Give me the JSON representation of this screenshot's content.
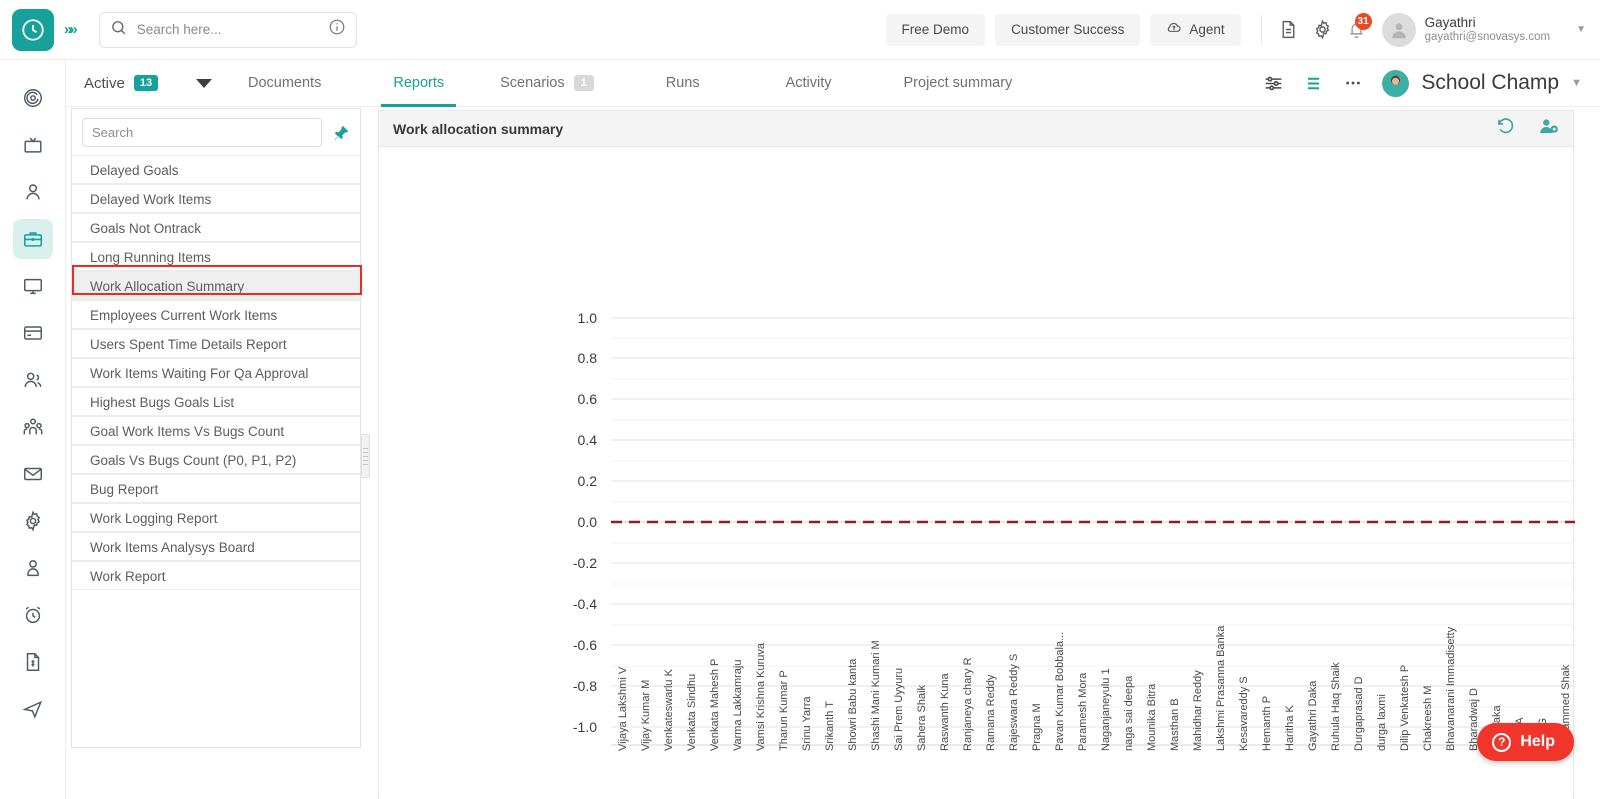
{
  "header": {
    "logo_icon": "clock-logo-icon",
    "expand_icon": "double-chevron-right-icon",
    "search_placeholder": "Search here...",
    "search_value": "",
    "search_icon": "search-icon",
    "info_icon": "info-circle-icon",
    "buttons": [
      {
        "label": "Free Demo",
        "icon": ""
      },
      {
        "label": "Customer Success",
        "icon": ""
      },
      {
        "label": "Agent",
        "icon": "cloud-upload-icon"
      }
    ],
    "doc_icon": "document-icon",
    "gear_icon": "gear-icon",
    "bell_icon": "bell-icon",
    "notification_count": "31",
    "avatar_icon": "avatar",
    "user_name": "Gayathri",
    "user_email": "gayathri@snovasys.com",
    "caret_icon": "chevron-down-icon"
  },
  "sidebar": {
    "items": [
      {
        "name": "target-icon"
      },
      {
        "name": "tv-icon"
      },
      {
        "name": "person-icon"
      },
      {
        "name": "briefcase-icon",
        "active": true
      },
      {
        "name": "monitor-icon"
      },
      {
        "name": "card-icon"
      },
      {
        "name": "two-people-icon"
      },
      {
        "name": "group-people-icon"
      },
      {
        "name": "mail-icon"
      },
      {
        "name": "settings-gear-icon"
      },
      {
        "name": "user-profile-icon"
      },
      {
        "name": "alarm-clock-icon"
      },
      {
        "name": "invoice-icon"
      },
      {
        "name": "send-icon"
      }
    ]
  },
  "tabbar": {
    "active_label": "Active",
    "active_count": "13",
    "dropdown_icon": "triangle-down-icon",
    "tabs": [
      {
        "label": "Documents",
        "selected": false,
        "badge": ""
      },
      {
        "label": "Reports",
        "selected": true,
        "badge": ""
      },
      {
        "label": "Scenarios",
        "selected": false,
        "badge": "1"
      },
      {
        "label": "Runs",
        "selected": false,
        "badge": ""
      },
      {
        "label": "Activity",
        "selected": false,
        "badge": ""
      },
      {
        "label": "Project summary",
        "selected": false,
        "badge": ""
      }
    ],
    "filter_icon": "filter-sliders-icon",
    "list_icon": "list-lines-icon",
    "more_icon": "more-horizontal-icon",
    "project_avatar": "project-avatar",
    "project_name": "School Champ",
    "project_caret": "chevron-down-icon"
  },
  "reportlist": {
    "search_placeholder": "Search",
    "search_value": "",
    "pin_icon": "pin-icon",
    "items": [
      {
        "label": "Delayed Goals",
        "selected": false
      },
      {
        "label": "Delayed Work Items",
        "selected": false
      },
      {
        "label": "Goals Not Ontrack",
        "selected": false
      },
      {
        "label": "Long Running Items",
        "selected": false
      },
      {
        "label": "Work Allocation Summary",
        "selected": true
      },
      {
        "label": "Employees Current Work Items",
        "selected": false
      },
      {
        "label": "Users Spent Time Details Report",
        "selected": false
      },
      {
        "label": "Work Items Waiting For Qa Approval",
        "selected": false
      },
      {
        "label": "Highest Bugs Goals List",
        "selected": false
      },
      {
        "label": "Goal Work Items Vs Bugs Count",
        "selected": false
      },
      {
        "label": "Goals Vs Bugs Count (P0, P1, P2)",
        "selected": false
      },
      {
        "label": "Bug Report",
        "selected": false
      },
      {
        "label": "Work Logging Report",
        "selected": false
      },
      {
        "label": "Work Items Analysys Board",
        "selected": false
      },
      {
        "label": "Work Report",
        "selected": false
      }
    ],
    "resizer_icon": "panel-resize-handle"
  },
  "chart_panel": {
    "title": "Work allocation summary",
    "refresh_icon": "undo-refresh-icon",
    "assign_user_icon": "user-settings-icon"
  },
  "chart_data": {
    "type": "bar",
    "title": "Work allocation summary",
    "xlabel": "",
    "ylabel": "",
    "ylim": [
      -1.0,
      1.0
    ],
    "ytick_labels": [
      "1.0",
      "0.8",
      "0.6",
      "0.4",
      "0.2",
      "0.0",
      "-0.2",
      "-0.4",
      "-0.6",
      "-0.8",
      "-1.0"
    ],
    "ytick_values": [
      1.0,
      0.8,
      0.6,
      0.4,
      0.2,
      0.0,
      -0.2,
      -0.4,
      -0.6,
      -0.8,
      -1.0
    ],
    "grid": true,
    "minor_grid": true,
    "zero_line": true,
    "zero_line_color": "#8e2020",
    "zero_line_style": "dashed",
    "legend": "none",
    "categories": [
      "Vijaya Lakshmi V",
      "Vijay Kumar M",
      "Venkateswarlu K",
      "Venkata Sindhu",
      "Venkata Mahesh P",
      "Varma Lakkamraju",
      "Vamsi Krishna Kuruva",
      "Tharun Kumar P",
      "Srinu Yarra",
      "Srikanth T",
      "Showri Babu kanta",
      "Shashi Mani Kumari M",
      "Sai Prem Uyyuru",
      "Sahera Shaik",
      "Raswanth Kuna",
      "Ranjaneya chary R",
      "Ramana Reddy",
      "Rajeswara Reddy S",
      "Pragna M",
      "Pavan Kumar Bobbala...",
      "Paramesh Mora",
      "Naganjaneyulu 1",
      "naga sai deepa",
      "Mounika Bitra",
      "Masthan B",
      "Mahidhar Reddy",
      "Lakshmi Prasanna Banka",
      "Kesavareddy S",
      "Hemanth P",
      "Haritha K",
      "Gayathri Daka",
      "Ruhula Haq Shaik",
      "Durgaprasad D",
      "durga laxmi",
      "Dilip Venkatesh P",
      "Chakreesh M",
      "Bhavanarani Immadisetty",
      "Bharadwaj D",
      "Anil Vaka",
      "Akhil A",
      "Ajith G",
      "Mohammed Shak"
    ],
    "values": [
      0,
      0,
      0,
      0,
      0,
      0,
      0,
      0,
      0,
      0,
      0,
      0,
      0,
      0,
      0,
      0,
      0,
      0,
      0,
      0,
      0,
      0,
      0,
      0,
      0,
      0,
      0,
      0,
      0,
      0,
      0,
      0,
      0,
      0,
      0,
      0,
      0,
      0,
      0,
      0,
      0,
      0
    ]
  },
  "help": {
    "label": "Help",
    "icon": "question-circle-icon"
  }
}
